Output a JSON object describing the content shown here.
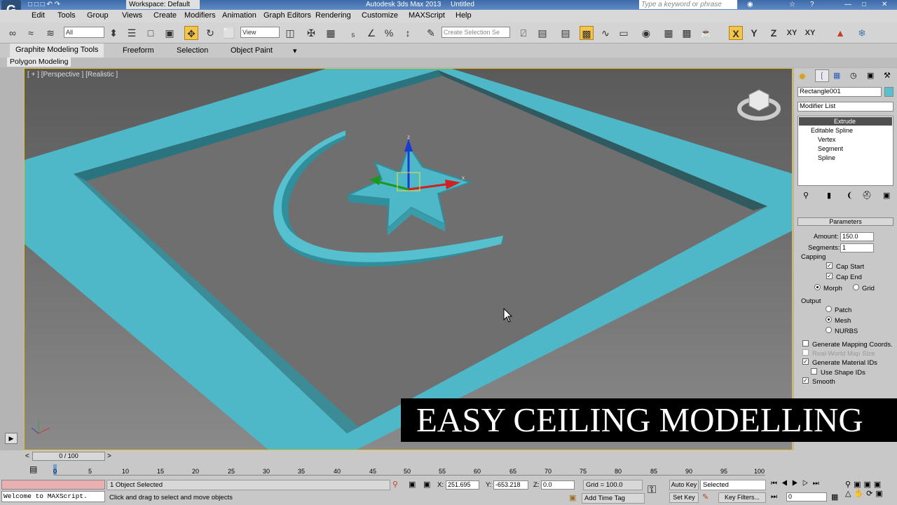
{
  "titlebar": {
    "workspace": "Workspace: Default",
    "app": "Autodesk 3ds Max  2013",
    "doc": "Untitled",
    "search_placeholder": "Type a keyword or phrase"
  },
  "menu": [
    "Edit",
    "Tools",
    "Group",
    "Views",
    "Create",
    "Modifiers",
    "Animation",
    "Graph Editors",
    "Rendering",
    "Customize",
    "MAXScript",
    "Help"
  ],
  "toolbar": {
    "filter": "All",
    "refcoord": "View",
    "selection_set": "Create Selection Se",
    "axes": [
      "X",
      "Y",
      "Z",
      "XY",
      "XY"
    ]
  },
  "ribbon": {
    "tabs": [
      "Graphite Modeling Tools",
      "Freeform",
      "Selection",
      "Object Paint"
    ],
    "panel": "Polygon Modeling"
  },
  "viewport": {
    "label": "[ + ] [Perspective ] [Realistic ]"
  },
  "panel": {
    "object_name": "Rectangle001",
    "modifier_list": "Modifier List",
    "stack": [
      "Extrude",
      "Editable Spline",
      "Vertex",
      "Segment",
      "Spline"
    ],
    "rollout": "Parameters",
    "amount_label": "Amount:",
    "amount": "150.0",
    "segments_label": "Segments:",
    "segments": "1",
    "capping": "Capping",
    "cap_start": "Cap Start",
    "cap_end": "Cap End",
    "morph": "Morph",
    "grid": "Grid",
    "output": "Output",
    "patch": "Patch",
    "mesh": "Mesh",
    "nurbs": "NURBS",
    "gen_mapping": "Generate Mapping Coords.",
    "real_world": "Real-World Map Size",
    "gen_matids": "Generate Material IDs",
    "use_shape_ids": "Use Shape IDs",
    "smooth": "Smooth"
  },
  "timeline": {
    "frame": "0 / 100",
    "ticks": [
      "0",
      "5",
      "10",
      "15",
      "20",
      "25",
      "30",
      "35",
      "40",
      "45",
      "50",
      "55",
      "60",
      "65",
      "70",
      "75",
      "80",
      "85",
      "90",
      "95",
      "100"
    ]
  },
  "status": {
    "listener": "Welcome to MAXScript.",
    "selected": "1 Object Selected",
    "prompt": "Click and drag to select and move objects",
    "x_label": "X:",
    "x": "251.695",
    "y_label": "Y:",
    "y": "-653.218",
    "z_label": "Z:",
    "z": "0.0",
    "grid": "Grid = 100.0",
    "add_time_tag": "Add Time Tag",
    "auto_key": "Auto Key",
    "set_key": "Set Key",
    "key_mode": "Selected",
    "key_filters": "Key Filters...",
    "frame_field": "0"
  },
  "overlay": "EASY CEILING MODELLING"
}
